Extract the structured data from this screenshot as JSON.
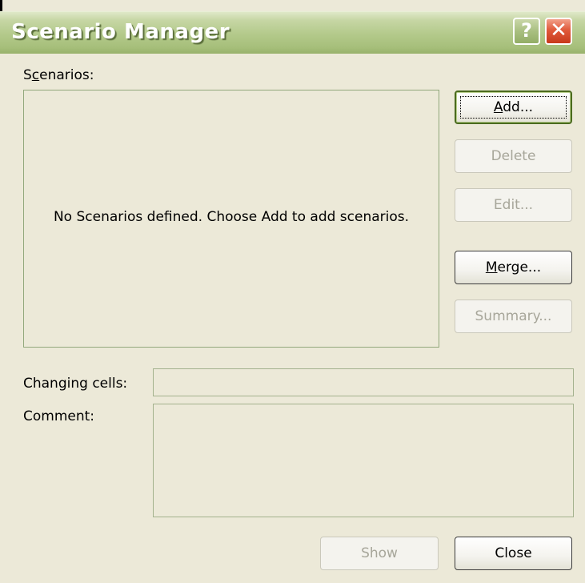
{
  "window": {
    "title": "Scenario Manager",
    "help_glyph": "?",
    "close_glyph": "✕"
  },
  "scenarios": {
    "label_prefix": "S",
    "label_mnemonic": "c",
    "label_suffix": "enarios:",
    "empty_message": "No Scenarios defined. Choose Add to add scenarios."
  },
  "buttons": {
    "add_mnemonic": "A",
    "add_rest": "dd...",
    "delete": "Delete",
    "edit": "Edit...",
    "merge_mnemonic": "M",
    "merge_rest": "erge...",
    "summary": "Summary...",
    "show": "Show",
    "close": "Close"
  },
  "fields": {
    "changing_cells_label": "Changing cells:",
    "changing_cells_value": "",
    "comment_label": "Comment:",
    "comment_value": ""
  }
}
